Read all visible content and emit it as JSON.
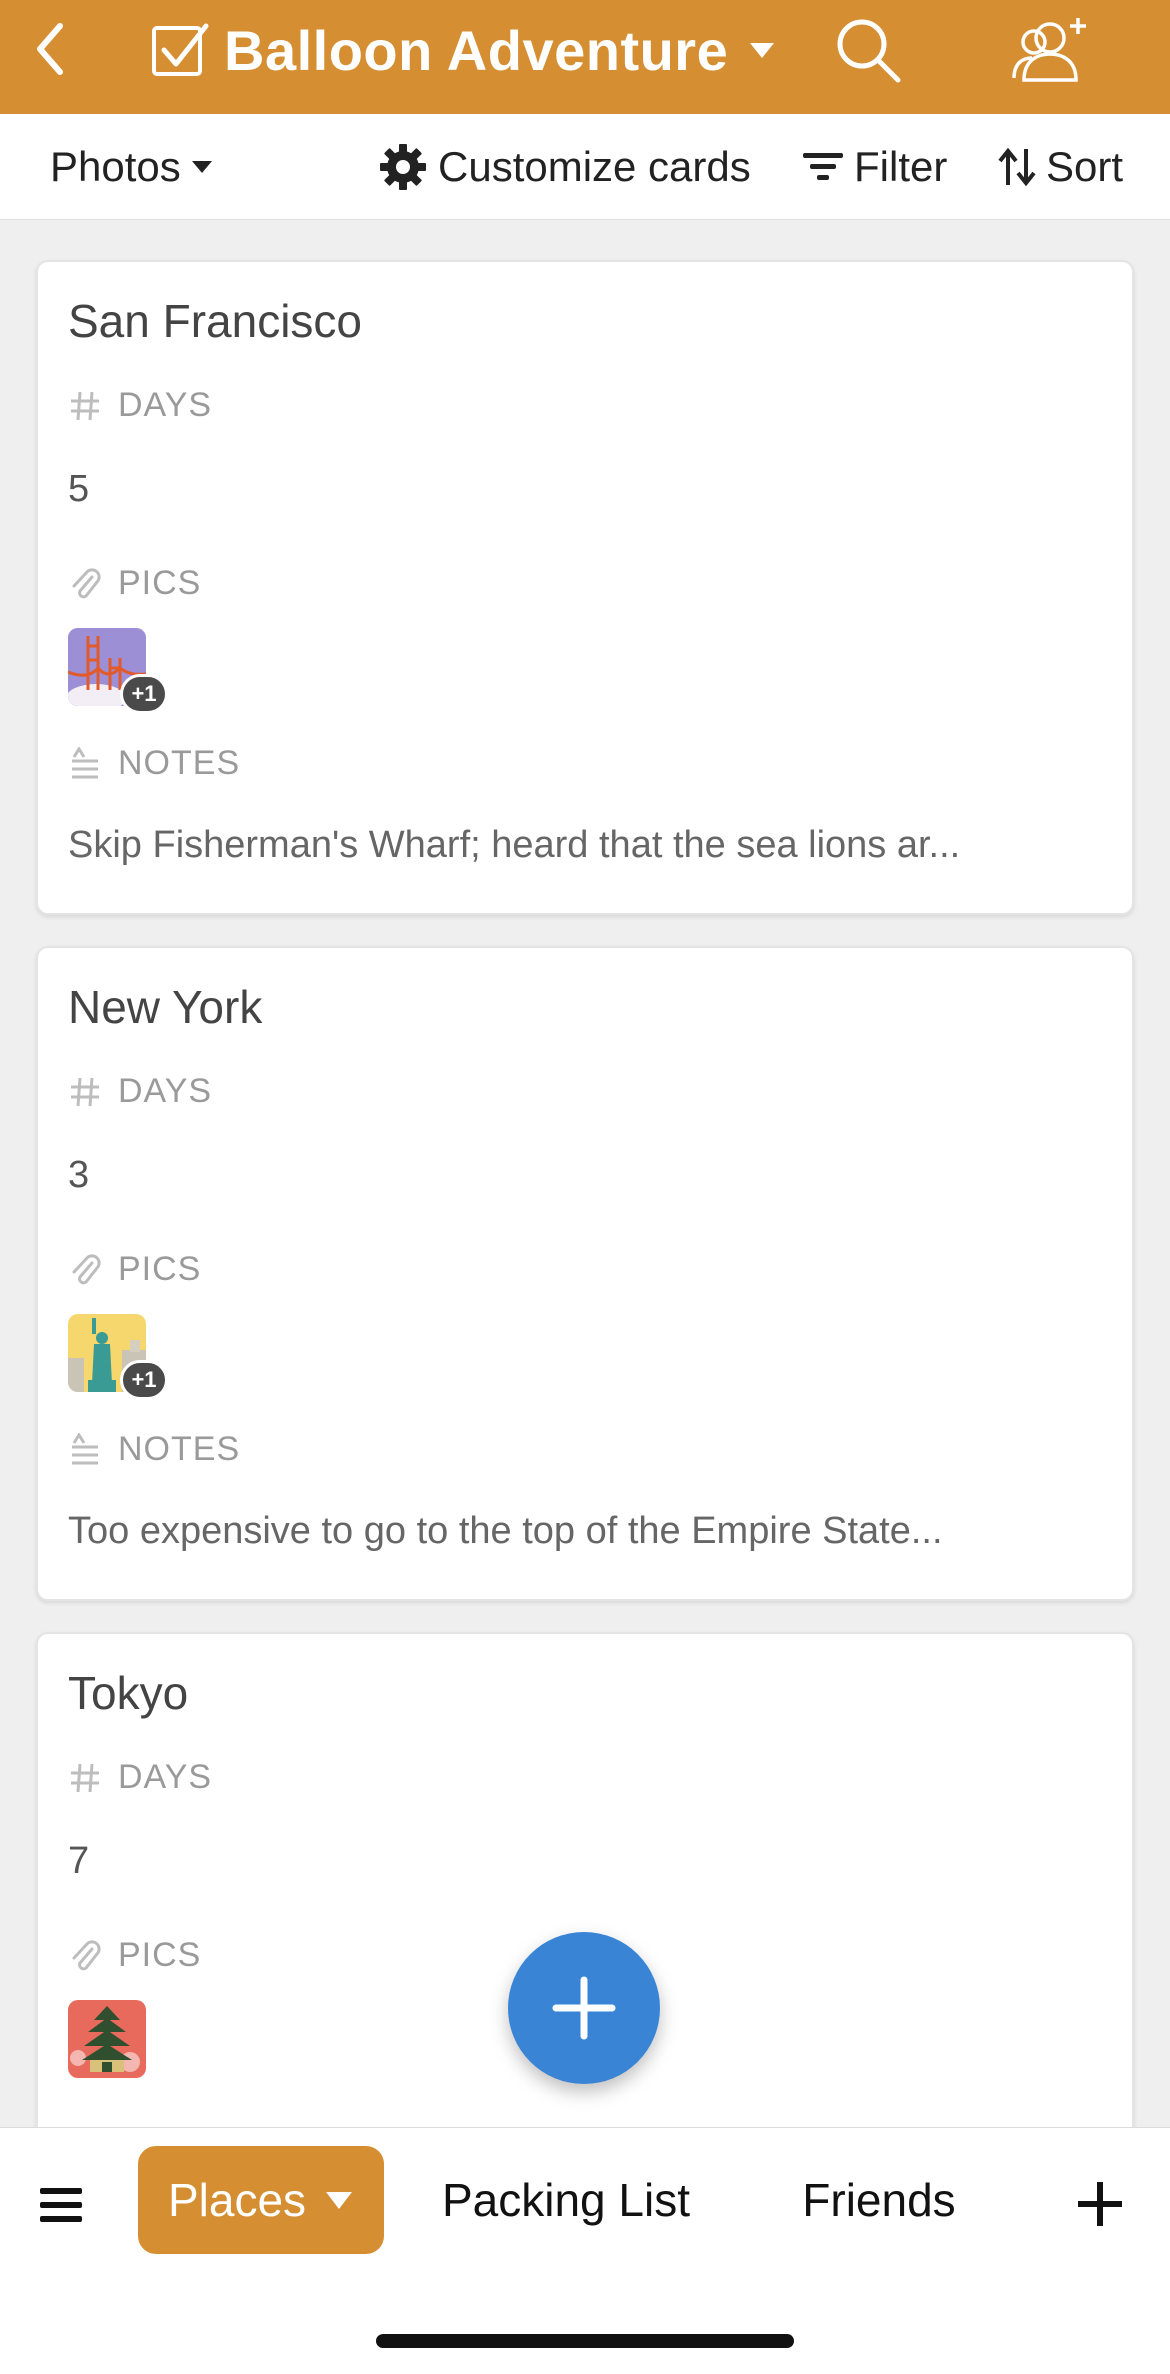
{
  "header": {
    "title": "Balloon Adventure",
    "bg_color": "#d58f32"
  },
  "toolbar": {
    "view_label": "Photos",
    "customize_label": "Customize cards",
    "filter_label": "Filter",
    "sort_label": "Sort"
  },
  "fields": {
    "days": "DAYS",
    "pics": "PICS",
    "notes": "NOTES"
  },
  "cards": [
    {
      "name": "San Francisco",
      "days": "5",
      "pics_extra": "+1",
      "notes": "Skip Fisherman's Wharf; heard that the sea lions ar..."
    },
    {
      "name": "New York",
      "days": "3",
      "pics_extra": "+1",
      "notes": "Too expensive to go to the top of the Empire State..."
    },
    {
      "name": "Tokyo",
      "days": "7"
    }
  ],
  "tabs": {
    "active": "Places",
    "packing": "Packing List",
    "friends": "Friends"
  },
  "fab": {
    "color": "#3a84d6"
  },
  "icons": [
    "back-icon",
    "checkbox-icon",
    "chevron-down-icon",
    "search-icon",
    "add-user-icon",
    "gear-icon",
    "filter-icon",
    "sort-icon",
    "hash-icon",
    "paperclip-icon",
    "notes-icon",
    "plus-icon",
    "menu-icon"
  ]
}
